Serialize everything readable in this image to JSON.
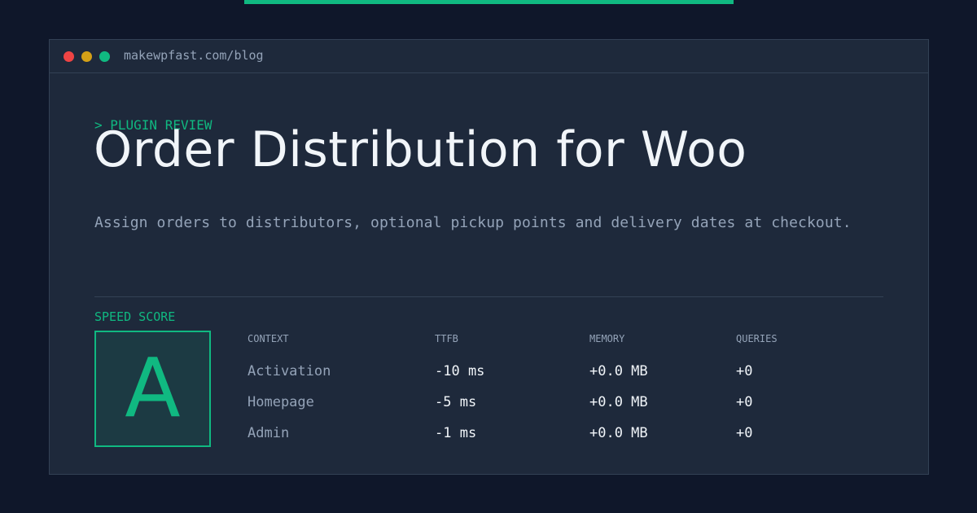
{
  "window": {
    "url": "makewpfast.com/blog",
    "controls": {
      "close_color": "#ef4444",
      "minimize_color": "#d4a017",
      "maximize_color": "#10b981"
    }
  },
  "header": {
    "eyebrow": "> PLUGIN REVIEW",
    "title": "Order Distribution for Woo",
    "subtitle": "Assign orders to distributors, optional pickup points and delivery dates at checkout."
  },
  "speed": {
    "label": "SPEED SCORE",
    "grade": "A"
  },
  "table": {
    "headers": [
      "CONTEXT",
      "TTFB",
      "MEMORY",
      "QUERIES"
    ],
    "rows": [
      {
        "context": "Activation",
        "ttfb": "-10 ms",
        "memory": "+0.0 MB",
        "queries": "+0"
      },
      {
        "context": "Homepage",
        "ttfb": "-5 ms",
        "memory": "+0.0 MB",
        "queries": "+0"
      },
      {
        "context": "Admin",
        "ttfb": "-1 ms",
        "memory": "+0.0 MB",
        "queries": "+0"
      }
    ]
  },
  "colors": {
    "background": "#0f172a",
    "panel": "#1e293b",
    "accent": "#10b981",
    "border": "#334155",
    "muted_text": "#94a3b8",
    "primary_text": "#f1f5f9"
  }
}
